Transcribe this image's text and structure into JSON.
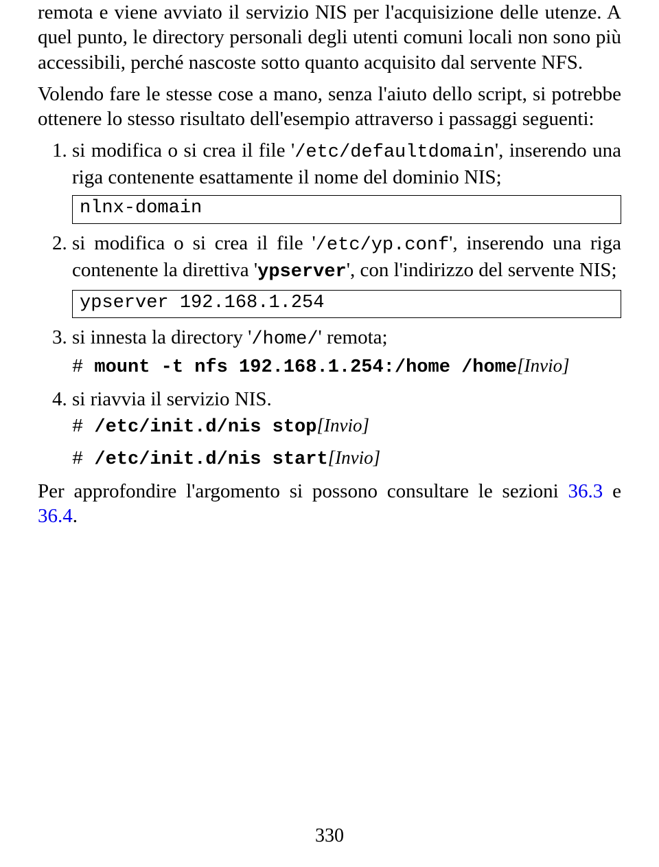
{
  "paragraphs": {
    "p1_seg1": "remota e viene avviato il servizio NIS per l'acquisizione delle utenze. A quel punto, le directory personali degli utenti comuni locali non sono più accessibili, perché nascoste sotto quanto acquisito dal servente NFS.",
    "p2_seg1": "Volendo fare le stesse cose a mano, senza l'aiuto dello script, si potrebbe ottenere lo stesso risultato dell'esempio attraverso i passaggi seguenti:"
  },
  "list": {
    "item1": {
      "pre": "si modifica o si crea il file '",
      "code": "/etc/defaultdomain",
      "post": "', inserendo una riga contenente esattamente il nome del dominio NIS;",
      "box": "nlnx-domain"
    },
    "item2": {
      "pre": "si modifica o si crea il file '",
      "code": "/etc/yp.conf",
      "mid": "', inserendo una riga contenente la direttiva '",
      "code2": "ypserver",
      "post": "', con l'indirizzo del servente NIS;",
      "box": "ypserver 192.168.1.254"
    },
    "item3": {
      "pre": "si innesta la directory '",
      "code": "/home/",
      "post": "' remota;",
      "cmd_prompt": "# ",
      "cmd": "mount -t nfs 192.168.1.254:/home /home",
      "key_open": "[",
      "key_text": "Invio",
      "key_close": "]"
    },
    "item4": {
      "text": "si riavvia il servizio NIS.",
      "cmd1_prompt": "# ",
      "cmd1": "/etc/init.d/nis stop",
      "cmd2_prompt": "# ",
      "cmd2": "/etc/init.d/nis start",
      "key_open": "[",
      "key_text": "Invio",
      "key_close": "]"
    }
  },
  "footer_para": {
    "pre": "Per approfondire l'argomento si possono consultare le sezioni ",
    "link1": "36.3",
    "mid": " e ",
    "link2": "36.4",
    "post": "."
  },
  "page_number": "330"
}
